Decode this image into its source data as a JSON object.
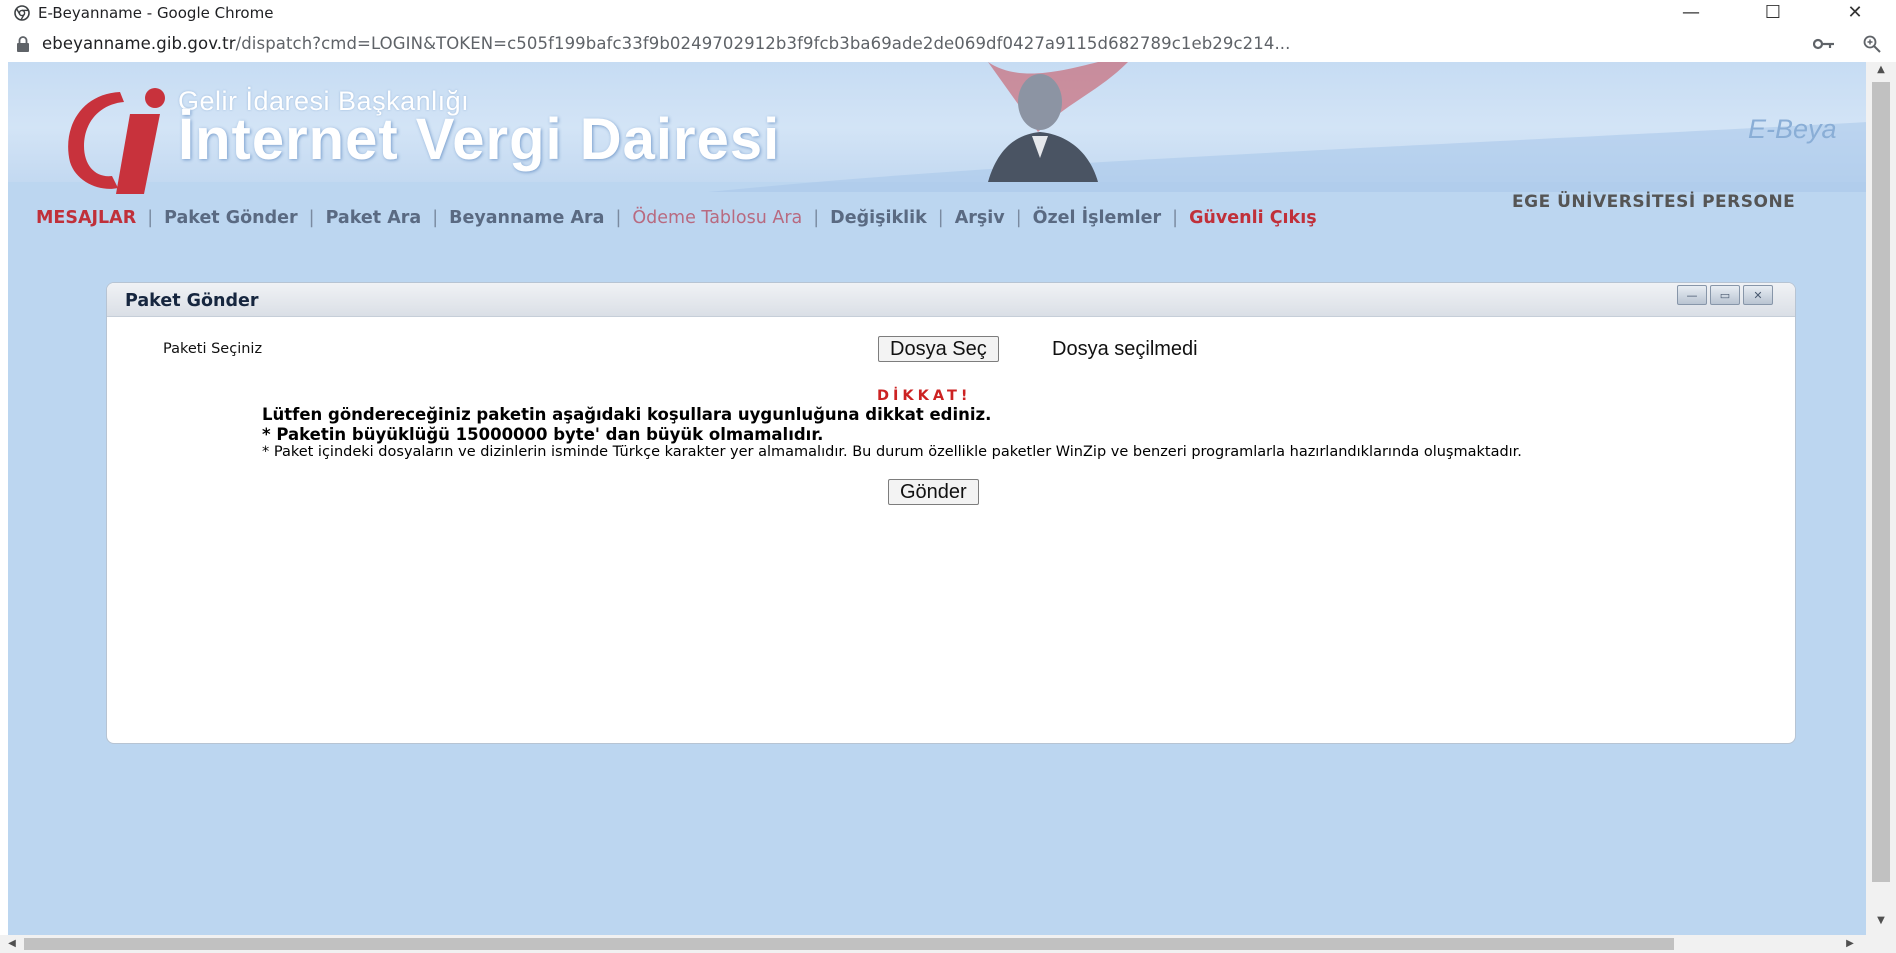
{
  "window": {
    "title": "E-Beyanname - Google Chrome",
    "controls": {
      "minimize": "—",
      "maximize": "☐",
      "close": "✕"
    }
  },
  "address": {
    "host": "ebeyanname.gib.gov.tr",
    "path": "/dispatch?cmd=LOGIN&TOKEN=c505f199bafc33f9b0249702912b3f9fcb3ba69ade2de069df0427a9115d682789c1eb29c214...",
    "icons": [
      "lock-icon",
      "key-icon",
      "zoom-icon"
    ]
  },
  "banner": {
    "subtitle": "Gelir İdaresi Başkanlığı",
    "title": "İnternet Vergi Dairesi",
    "right_label": "E-Beya"
  },
  "company": "EGE ÜNİVERSİTESİ PERSONE",
  "nav": {
    "items": [
      {
        "label": "MESAJLAR"
      },
      {
        "label": "Paket Gönder"
      },
      {
        "label": "Paket Ara"
      },
      {
        "label": "Beyanname Ara"
      },
      {
        "label": "Ödeme Tablosu Ara"
      },
      {
        "label": "Değişiklik"
      },
      {
        "label": "Arşiv"
      },
      {
        "label": "Özel İşlemler"
      },
      {
        "label": "Güvenli Çıkış"
      }
    ],
    "separator": "|"
  },
  "panel": {
    "title": "Paket Gönder",
    "field_label": "Paketi Seçiniz",
    "file_button": "Dosya Seç",
    "file_status": "Dosya seçilmedi",
    "warning_title": "DİKKAT!",
    "line1": "Lütfen göndereceğiniz paketin aşağıdaki koşullara uygunluğuna dikkat ediniz.",
    "line2": "* Paketin büyüklüğü 15000000 byte' dan büyük olmamalıdır.",
    "line3": "* Paket içindeki dosyaların ve dizinlerin isminde Türkçe karakter yer almamalıdır. Bu durum özellikle paketler WinZip ve benzeri programlarla hazırlandıklarında oluşmaktadır.",
    "send_button": "Gönder"
  },
  "colors": {
    "page_bg": "#bcd6f0",
    "nav_text": "#5a6a82",
    "nav_active": "#c0303a",
    "warning": "#cc2222"
  }
}
